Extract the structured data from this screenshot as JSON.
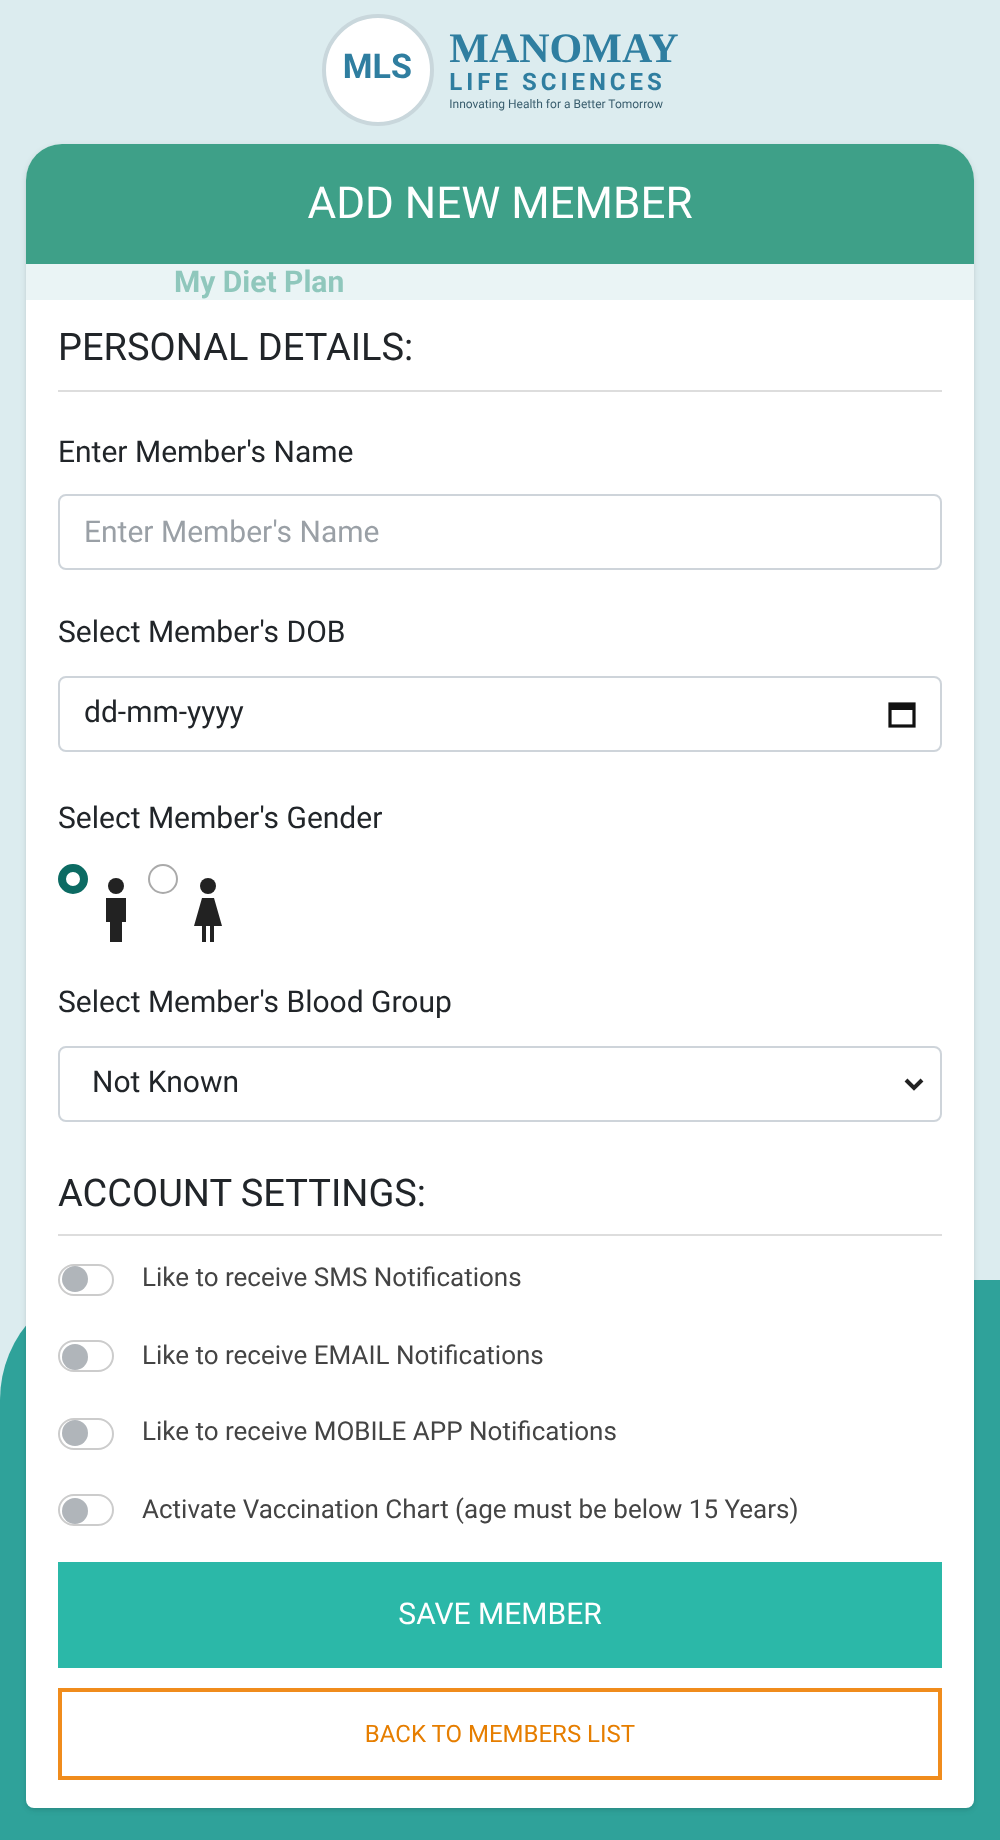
{
  "logo": {
    "monogram": "MLS",
    "name": "MANOMAY",
    "subname": "LIFE SCIENCES",
    "tagline": "Innovating Health for a Better Tomorrow"
  },
  "background_text": "My Diet Plan",
  "title": "ADD NEW MEMBER",
  "personal": {
    "heading": "PERSONAL DETAILS:",
    "name_field": {
      "label": "Enter Member's Name",
      "placeholder": "Enter Member's Name"
    },
    "dob_field": {
      "label": "Select Member's DOB",
      "value": "dd-mm-yyyy"
    },
    "gender": {
      "label": "Select Member's Gender",
      "options": [
        {
          "kind": "male",
          "selected": true
        },
        {
          "kind": "female",
          "selected": false
        }
      ]
    },
    "blood_group": {
      "label": "Select Member's Blood Group",
      "value": "Not Known"
    }
  },
  "account": {
    "heading": "ACCOUNT SETTINGS:",
    "settings": [
      {
        "label": "Like to receive SMS Notifications",
        "on": false
      },
      {
        "label": "Like to receive EMAIL Notifications",
        "on": false
      },
      {
        "label": "Like to receive MOBILE APP Notifications",
        "on": false
      },
      {
        "label": "Activate Vaccination Chart (age must be below 15 Years)",
        "on": false
      }
    ]
  },
  "buttons": {
    "save": "SAVE MEMBER",
    "back": "BACK TO MEMBERS LIST"
  }
}
